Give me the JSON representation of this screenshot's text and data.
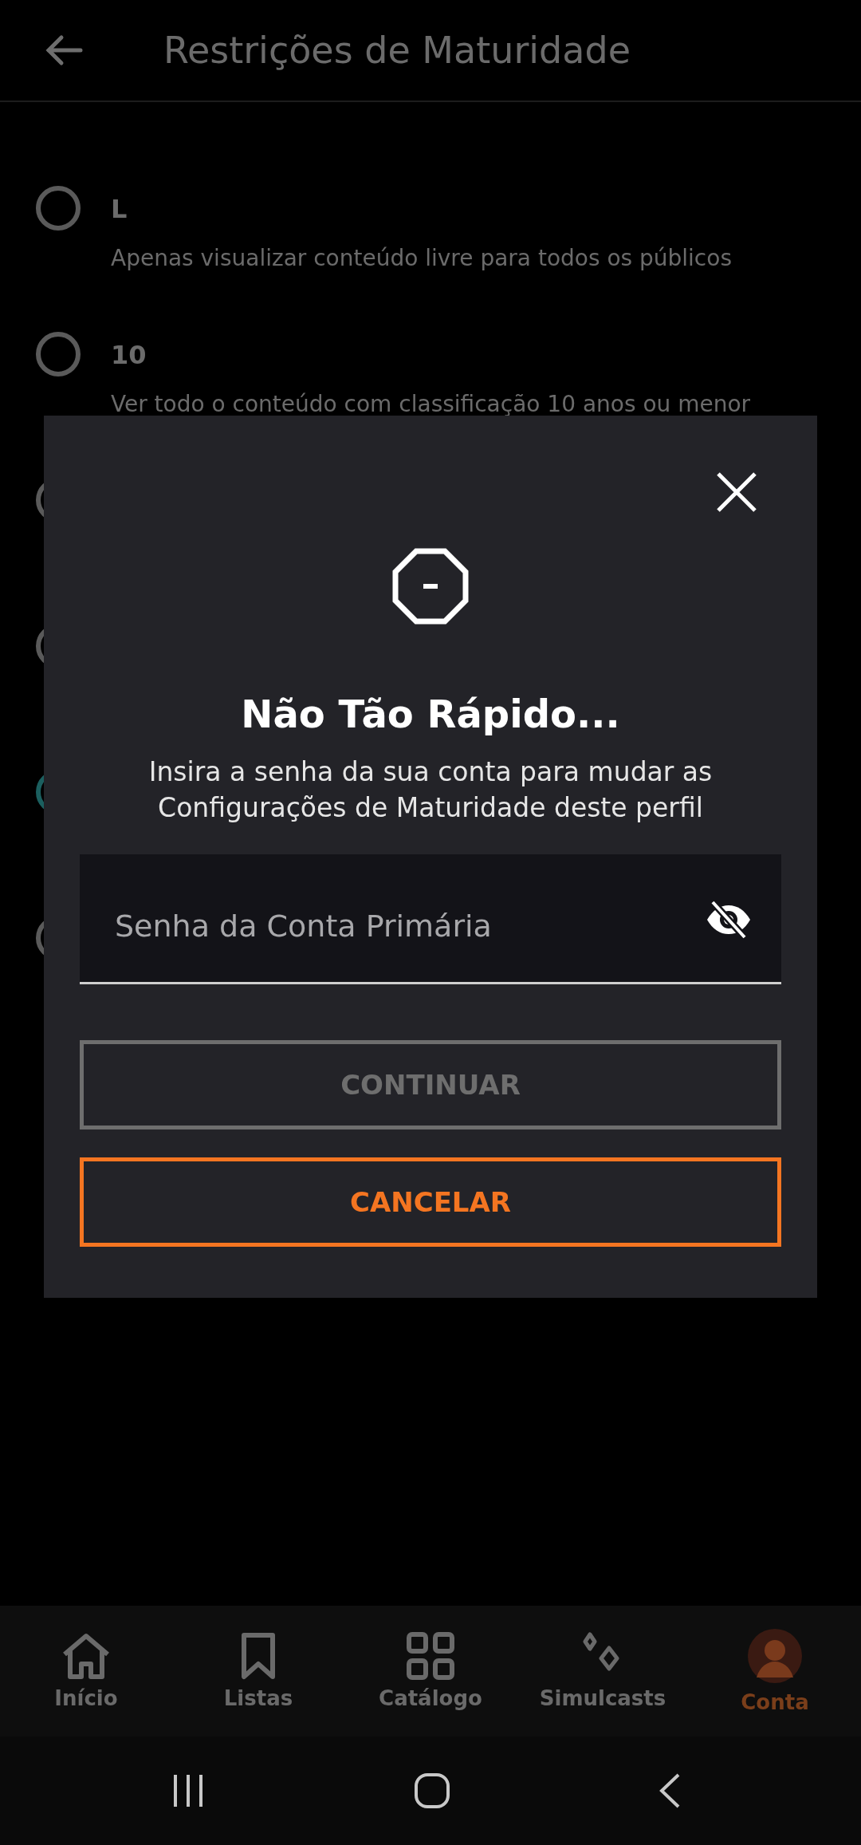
{
  "header": {
    "title": "Restrições de Maturidade"
  },
  "options": [
    {
      "label": "L",
      "description": "Apenas visualizar conteúdo livre para todos os públicos",
      "selected": false
    },
    {
      "label": "10",
      "description": "Ver todo o conteúdo com classificação 10 anos ou menor",
      "selected": false
    },
    {
      "selected": false
    },
    {
      "selected": false
    },
    {
      "selected": true
    },
    {
      "selected": false
    }
  ],
  "dialog": {
    "title": "Não Tão Rápido...",
    "message": "Insira a senha da sua conta para mudar as Configurações de Maturidade deste perfil",
    "password_field": {
      "placeholder": "Senha da Conta Primária",
      "visible": false
    },
    "buttons": [
      {
        "label": "CONTINUAR",
        "kind": "primary",
        "disabled": true
      },
      {
        "label": "CANCELAR",
        "kind": "secondary",
        "disabled": false
      }
    ]
  },
  "bottom_nav": [
    {
      "label": "Início",
      "kind": "home",
      "selected": false
    },
    {
      "label": "Listas",
      "kind": "bookmark",
      "selected": false
    },
    {
      "label": "Catálogo",
      "kind": "grid",
      "selected": false
    },
    {
      "label": "Simulcasts",
      "kind": "sparkle",
      "selected": false
    },
    {
      "label": "Conta",
      "kind": "avatar",
      "selected": true
    }
  ]
}
